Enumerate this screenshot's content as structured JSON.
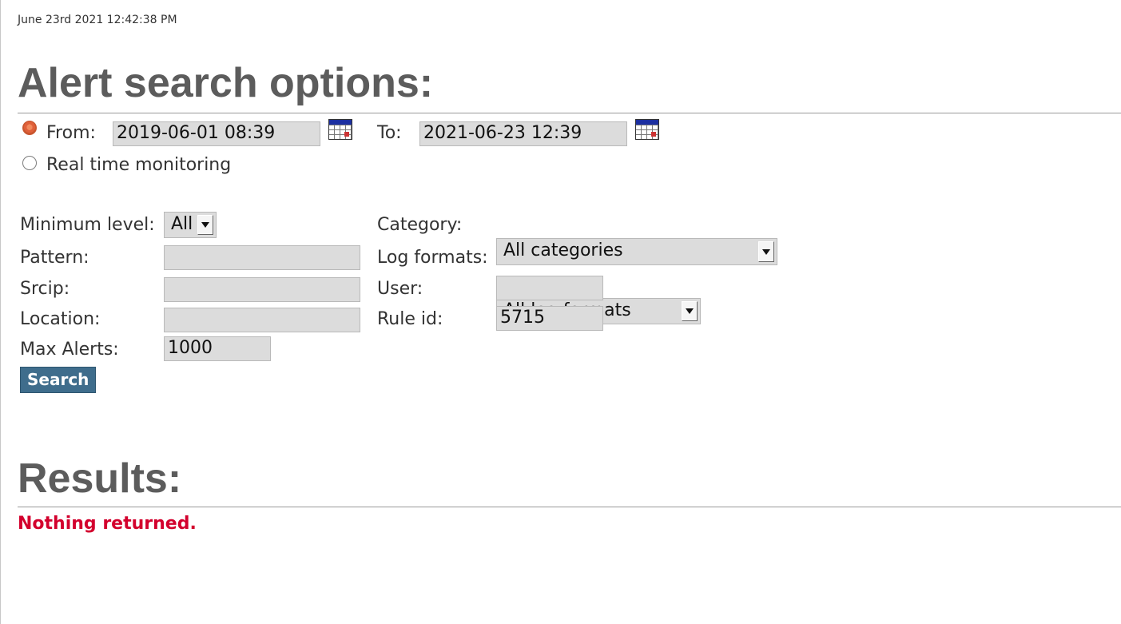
{
  "timestamp": "June 23rd 2021 12:42:38 PM",
  "search": {
    "heading": "Alert search options:",
    "from_label": "From:",
    "from_value": "2019-06-01 08:39",
    "to_label": "To:",
    "to_value": "2021-06-23 12:39",
    "realtime_label": "Real time monitoring",
    "selected_mode": "from",
    "min_level_label": "Minimum level:",
    "min_level_value": "All",
    "pattern_label": "Pattern:",
    "pattern_value": "",
    "srcip_label": "Srcip:",
    "srcip_value": "",
    "location_label": "Location:",
    "location_value": "",
    "max_alerts_label": "Max Alerts:",
    "max_alerts_value": "1000",
    "category_label": "Category:",
    "category_value": "All categories",
    "log_formats_label": "Log formats:",
    "log_formats_value": "All log formats",
    "user_label": "User:",
    "user_value": "",
    "rule_id_label": "Rule id:",
    "rule_id_value": "5715",
    "search_button": "Search"
  },
  "results": {
    "heading": "Results:",
    "message": "Nothing returned."
  },
  "colors": {
    "heading": "#5c5c5c",
    "button": "#3f6d8c",
    "error": "#d3002d",
    "field_bg": "#dcdcdc"
  },
  "icons": [
    "calendar-icon",
    "chevron-down-icon"
  ]
}
